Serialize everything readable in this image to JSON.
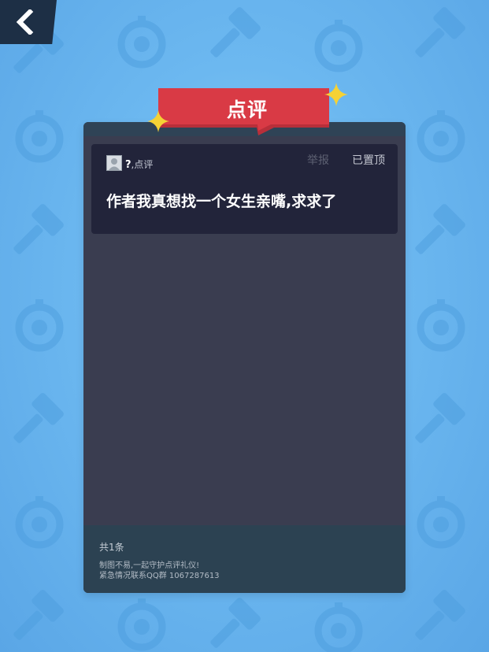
{
  "nav": {
    "back_icon": "chevron-left-icon"
  },
  "banner": {
    "title": "点评",
    "decoration": "sparkle-icon"
  },
  "comment": {
    "avatar_icon": "user-avatar-icon",
    "user_mark": "?",
    "user_suffix": ",点评",
    "report_label": "举报",
    "pinned_label": "已置顶",
    "text": "作者我真想找一个女生亲嘴,求求了"
  },
  "footer": {
    "count": "共1条",
    "notice_line1": "制图不易,一起守护点评礼仪!",
    "notice_line2": "紧急情况联系QQ群 1067287613"
  },
  "colors": {
    "background": "#6cb8f0",
    "panel": "#3a3d50",
    "card": "#22243a",
    "banner_red": "#d93a45",
    "sparkle": "#f5d235"
  }
}
